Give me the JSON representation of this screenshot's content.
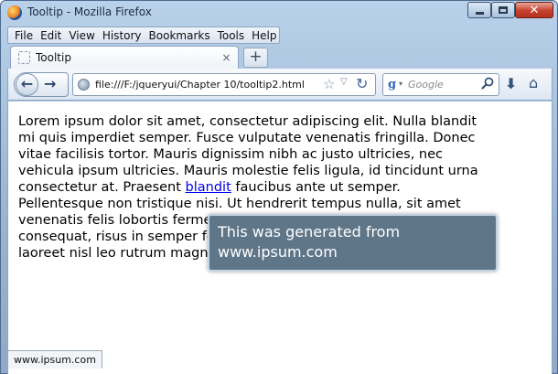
{
  "window": {
    "title": "Tooltip - Mozilla Firefox",
    "controls": {
      "close_glyph": "✕"
    }
  },
  "menubar": {
    "items": [
      "File",
      "Edit",
      "View",
      "History",
      "Bookmarks",
      "Tools",
      "Help"
    ]
  },
  "tabs": {
    "active": {
      "label": "Tooltip",
      "close_glyph": "×"
    },
    "new_tab_glyph": "+"
  },
  "navigation": {
    "back_glyph": "←",
    "forward_glyph": "→",
    "url": "file:///F:/jqueryui/Chapter 10/tooltip2.html",
    "search_placeholder": "Google",
    "search_engine_glyph": "g"
  },
  "page": {
    "line1": "Lorem ipsum dolor sit amet, consectetur adipiscing elit. Nulla blandit",
    "line2": "mi quis imperdiet semper. Fusce vulputate venenatis fringilla. Donec",
    "line3": "vitae facilisis tortor. Mauris dignissim nibh ac justo ultricies, nec",
    "line4": "vehicula ipsum ultricies. Mauris molestie felis ligula, id tincidunt urna",
    "line5_before": "consectetur at. Praesent ",
    "link": "blandit",
    "line5_after": " faucibus ante ut semper.",
    "line6": "Pellentesque non tristique nisi. Ut hendrerit tempus nulla, sit amet",
    "line7": "venenatis felis lobortis fermentum. Mauris nec orci sed dui tincidunt",
    "line8": "consequat, risus in semper feugiat, ipsum mauris vehicula nunc,",
    "line9": "laoreet nisl leo rutrum magna."
  },
  "tooltip": {
    "text": "This was generated from www.ipsum.com"
  },
  "statusbar": {
    "text": "www.ipsum.com"
  }
}
